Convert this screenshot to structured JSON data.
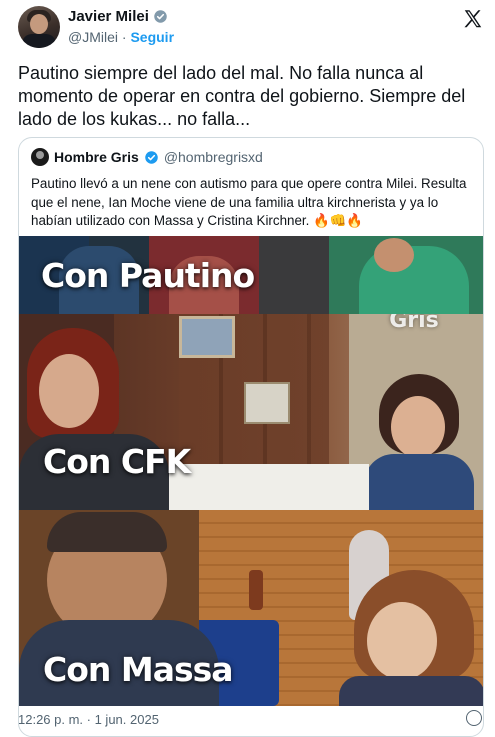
{
  "author": {
    "display_name": "Javier Milei",
    "handle": "@JMilei",
    "separator": "·",
    "follow_label": "Seguir"
  },
  "tweet": {
    "text": "Pautino siempre del lado del mal. No falla nunca al momento de operar en contra del gobierno. Siempre del lado de los kukas... no falla..."
  },
  "quote": {
    "display_name": "Hombre Gris",
    "handle": "@hombregrisxd",
    "text": "Pautino llevó a un nene con autismo para  que opere contra Milei. Resulta que el nene, Ian Moche viene de una familia ultra kirchnerista y ya lo habían utilizado con Massa y Cristina Kirchner. 🔥👊🔥",
    "media": {
      "panel1_label": "Con Pautino",
      "panel2_label": "Con CFK",
      "panel3_label": "Con Massa",
      "watermark": "Hombre Gris"
    }
  },
  "footer": {
    "timestamp": "12:26 p. m. · 1 jun. 2025"
  },
  "colors": {
    "accent": "#1d9bf0",
    "text": "#0f1419",
    "secondary": "#536471",
    "border": "#cfd9de"
  }
}
